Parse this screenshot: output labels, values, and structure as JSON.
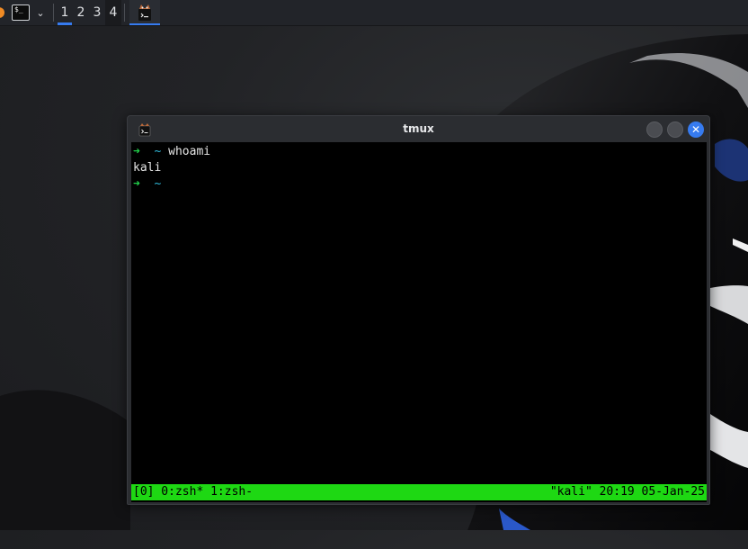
{
  "panel": {
    "workspaces": [
      "1",
      "2",
      "3",
      "4"
    ],
    "active_workspace": "1",
    "launcher_glyph": "$_",
    "chevron": "⌄",
    "taskbar": [
      {
        "app": "tmux",
        "active": true
      }
    ]
  },
  "window": {
    "title": "tmux",
    "close_glyph": "✕"
  },
  "terminal": {
    "lines": [
      {
        "arrow": "➜",
        "dir": "~",
        "command": "whoami"
      },
      {
        "output": "kali"
      },
      {
        "arrow": "➜",
        "dir": "~",
        "command": ""
      }
    ],
    "status_bar": {
      "left": "[0] 0:zsh* 1:zsh-",
      "right": "\"kali\" 20:19 05-Jan-25"
    }
  },
  "colors": {
    "accent": "#367bf0",
    "prompt_arrow": "#21d14b",
    "prompt_dir": "#2fb6d6",
    "status_bar": "#1ed813"
  },
  "icons": {
    "kali_menu": "kali-dragon-icon",
    "terminal_launcher": "terminal-icon",
    "tmux_app": "tmux-app-icon"
  }
}
